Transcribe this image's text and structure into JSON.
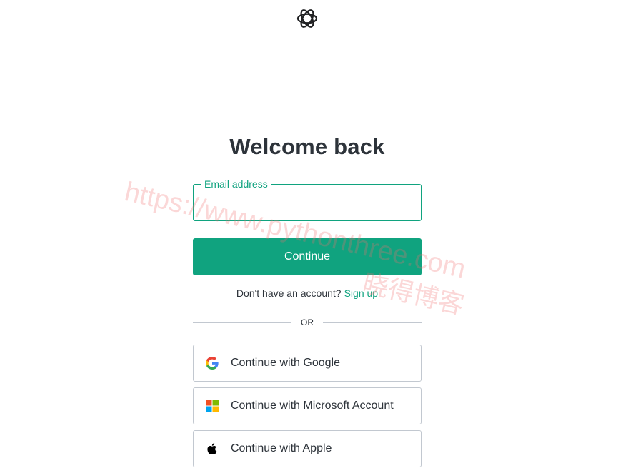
{
  "header": {
    "logo_icon": "openai-logo-icon"
  },
  "login": {
    "title": "Welcome back",
    "email_label": "Email address",
    "email_value": "",
    "continue_label": "Continue",
    "no_account_text": "Don't have an account?",
    "signup_link": "Sign up",
    "divider_text": "OR"
  },
  "social": [
    {
      "label": "Continue with Google",
      "icon": "google-icon"
    },
    {
      "label": "Continue with Microsoft Account",
      "icon": "microsoft-icon"
    },
    {
      "label": "Continue with Apple",
      "icon": "apple-icon"
    }
  ],
  "watermark": {
    "url": "https://www.pythonthree.com",
    "name": "晓得博客"
  },
  "colors": {
    "accent": "#10a37f",
    "text": "#2d333a",
    "border": "#c2c8d0"
  }
}
